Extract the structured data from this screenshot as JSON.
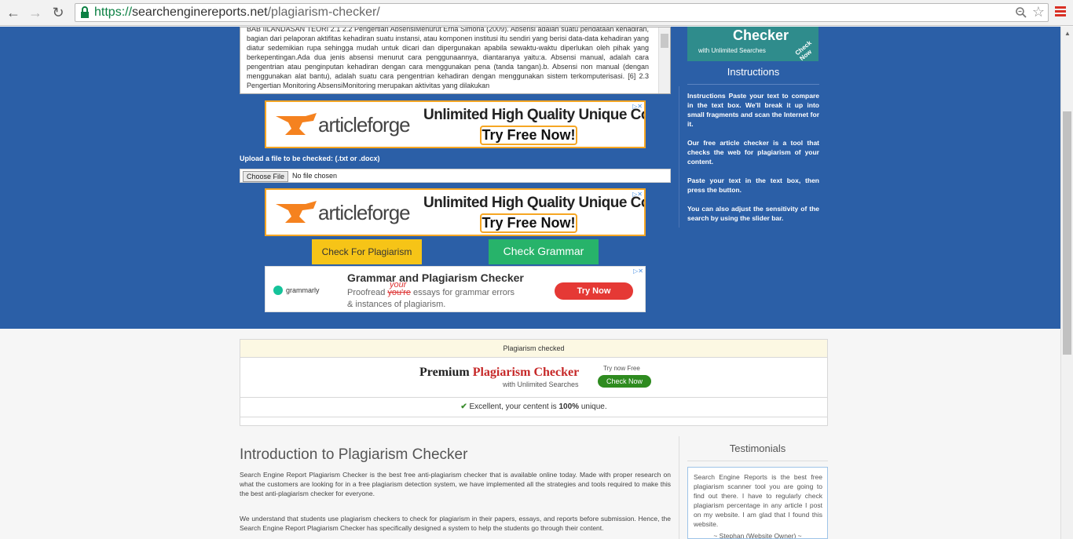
{
  "browser": {
    "url_scheme": "https://",
    "url_host": "searchenginereports.net",
    "url_path": "/plagiarism-checker/"
  },
  "checker": {
    "textarea_content": "BAB IILANDASAN TEORI 2.1 2.2 Pengertian AbsensiMenurut Erna Simona (2009). Absensi adalah suatu pendataan kehadiran, bagian dari pelaporan aktifitas kehadiran suatu instansi, atau komponen institusi itu sendiri yang berisi data-data kehadiran yang diatur sedemikian rupa sehingga mudah untuk dicari dan dipergunakan apabila sewaktu-waktu diperlukan oleh pihak yang berkepentingan.Ada dua jenis absensi menurut cara penggunaannya, diantaranya yaitu:a.      Absensi manual, adalah cara pengentrian atau penginputan kehadiran dengan cara menggunakan pena (tanda tangan).b.      Absensi non manual (dengan menggunakan alat bantu), adalah suatu cara pengentrian kehadiran dengan menggunakan sistem terkomputerisasi. [6] 2.3      Pengertian Monitoring AbsensiMonitoring merupakan aktivitas yang dilakukan",
    "upload_label": "Upload a file to be checked: (.txt or .docx)",
    "choose_file_label": "Choose File",
    "no_file_text": "No file chosen",
    "check_plagiarism_label": "Check For Plagiarism",
    "check_grammar_label": "Check Grammar"
  },
  "ads": {
    "articleforge_logo": "articleforge",
    "articleforge_headline": "Unlimited High Quality Unique Content",
    "articleforge_cta": "Try Free Now!",
    "grammarly_brand": "grammarly",
    "grammarly_title": "Grammar and Plagiarism Checker",
    "grammarly_line1_a": "Proofread ",
    "grammarly_strike": "you're",
    "grammarly_insert": "your",
    "grammarly_line1_b": " essays for grammar errors",
    "grammarly_line2": "& instances of plagiarism.",
    "grammarly_cta": "Try Now",
    "side_title": "Checker",
    "side_sub": "with Unlimited Searches",
    "side_check": "Check Now"
  },
  "instructions": {
    "title": "Instructions",
    "paragraphs": [
      "Instructions Paste your text to compare in the text box. We'll break it up into small fragments and scan the Internet for it.",
      "Our free article checker is a tool that checks the web for plagiarism of your content.",
      "Paste your text in the text box, then press the button.",
      "You can also adjust the sensitivity of the search by using the slider bar."
    ]
  },
  "result": {
    "header": "Plagiarism checked",
    "premium_title_a": "Premium ",
    "premium_title_b": "Plagiarism Checker",
    "premium_sub": "with Unlimited Searches",
    "premium_try": "Try now Free",
    "premium_btn": "Check Now",
    "msg_a": "Excellent, your centent is ",
    "msg_b": "100%",
    "msg_c": " unique."
  },
  "intro": {
    "title": "Introduction to Plagiarism Checker",
    "p1": "Search Engine Report Plagiarism Checker is the best free anti-plagiarism checker that is available online today. Made with proper research on what the customers are looking for in a free plagiarism detection system, we have implemented all the strategies and tools required to make this the best anti-plagiarism checker for everyone.",
    "p2": "We understand that students use plagiarism checkers to check for plagiarism in their papers, essays, and reports before submission. Hence, the Search Engine Report Plagiarism Checker has specifically designed a system to help the students go through their content."
  },
  "testimonials": {
    "title": "Testimonials",
    "text": "Search Engine Reports is the best free plagiarism scanner tool you are going to find out there. I have to regularly check plagiarism percentage in any article I post on my website. I am glad that I found this website.",
    "author": "~ Stephan (Website Owner) ~"
  }
}
